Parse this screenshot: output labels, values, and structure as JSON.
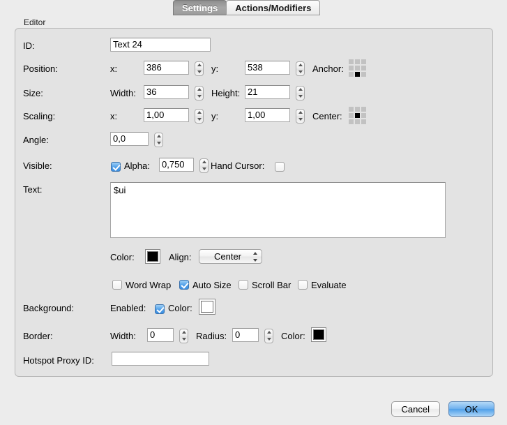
{
  "tabs": [
    {
      "label": "Settings",
      "active": true
    },
    {
      "label": "Actions/Modifiers",
      "active": false
    }
  ],
  "group": {
    "title": "Editor"
  },
  "fields": {
    "id": {
      "label": "ID:",
      "value": "Text 24"
    },
    "position": {
      "label": "Position:",
      "x_label": "x:",
      "x_value": "386",
      "y_label": "y:",
      "y_value": "538",
      "anchor_label": "Anchor:",
      "anchor_cells": [
        0,
        0,
        0,
        0,
        0,
        0,
        0,
        1,
        0
      ]
    },
    "size": {
      "label": "Size:",
      "width_label": "Width:",
      "width_value": "36",
      "height_label": "Height:",
      "height_value": "21"
    },
    "scaling": {
      "label": "Scaling:",
      "x_label": "x:",
      "x_value": "1,00",
      "y_label": "y:",
      "y_value": "1,00",
      "center_label": "Center:",
      "center_cells": [
        0,
        0,
        0,
        0,
        1,
        0,
        0,
        0,
        0
      ]
    },
    "angle": {
      "label": "Angle:",
      "value": "0,0"
    },
    "visible": {
      "label": "Visible:",
      "checked": true,
      "alpha_label": "Alpha:",
      "alpha_value": "0,750",
      "hand_cursor_label": "Hand Cursor:",
      "hand_cursor_checked": false
    },
    "text": {
      "label": "Text:",
      "value": "$ui"
    },
    "text_color": {
      "label": "Color:",
      "color": "#000000"
    },
    "align": {
      "label": "Align:",
      "value": "Center"
    },
    "options": [
      {
        "label": "Word Wrap",
        "checked": false
      },
      {
        "label": "Auto Size",
        "checked": true
      },
      {
        "label": "Scroll Bar",
        "checked": false
      },
      {
        "label": "Evaluate",
        "checked": false
      }
    ],
    "background": {
      "label": "Background:",
      "enabled_label": "Enabled:",
      "enabled_checked": true,
      "color_label": "Color:",
      "color": "#ffffff"
    },
    "border": {
      "label": "Border:",
      "width_label": "Width:",
      "width_value": "0",
      "radius_label": "Radius:",
      "radius_value": "0",
      "color_label": "Color:",
      "color": "#000000"
    },
    "hotspot": {
      "label": "Hotspot Proxy ID:",
      "value": ""
    }
  },
  "buttons": {
    "cancel": "Cancel",
    "ok": "OK"
  }
}
